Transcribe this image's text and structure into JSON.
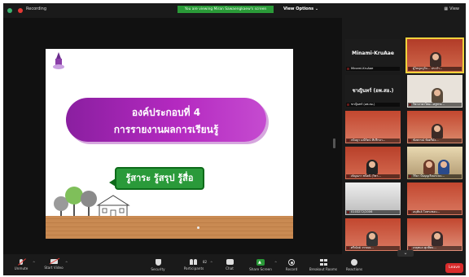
{
  "topbar": {
    "recording_label": "Recording",
    "share_banner": "You are viewing Miran Sawaengkaew's screen",
    "view_options": "View Options ⌄",
    "view_label": "View"
  },
  "slide": {
    "heading_line1": "องค์ประกอบที่ 4",
    "heading_line2": "การรายงานผลการเรียนรู้",
    "tag_text": "รู้สาระ รู้สรุป รู้สื่อ"
  },
  "gallery": {
    "tiles": [
      {
        "name": "Minami-KruAae",
        "big": "Minami-KruAae"
      },
      {
        "name": "ผู้ใหญ่ครูกิจ... ประจำ..."
      },
      {
        "name": "ชาญินทร์ (อพ.สอ.)",
        "big": "ชาญินทร์ (อพ.สอ.)"
      },
      {
        "name": "วิชาภาษาไทย...ครูพวง..."
      },
      {
        "name": "กนิษฐา มณีรัตน์ ที่ปรึกษา..."
      },
      {
        "name": "ชัยพรรณ์ ชัยตรีมัง..."
      },
      {
        "name": "เพ็ญนภา ชนิตนิ (วิชา..."
      },
      {
        "name": "วิริยา ปันบุญเรียนระบบ..."
      },
      {
        "name": "0103272/2006"
      },
      {
        "name": "อนุพันธ์ ใจทรงชอบ..."
      },
      {
        "name": "ศรีณัลย์ วรรณย..."
      },
      {
        "name": "เกตุชนก ศุภสิทธ..."
      }
    ],
    "more": "⌄"
  },
  "toolbar": {
    "unmute": "Unmute",
    "start_video": "Start Video",
    "security": "Security",
    "participants": "Participants",
    "participants_count": "82",
    "chat": "Chat",
    "share_screen": "Share Screen",
    "record": "Record",
    "breakout": "Breakout Rooms",
    "reactions": "Reactions",
    "leave": "Leave"
  }
}
